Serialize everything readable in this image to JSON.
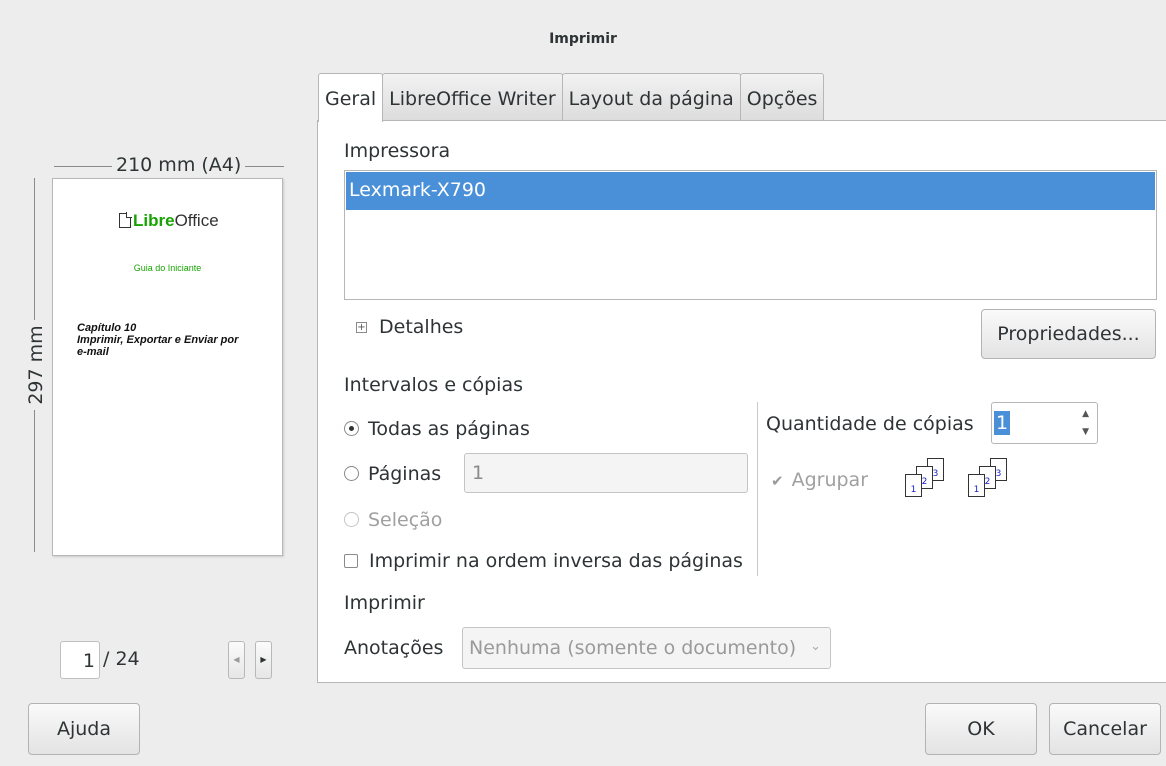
{
  "window": {
    "title": "Imprimir"
  },
  "preview": {
    "width_label": "210 mm (A4)",
    "height_label": "297 mm",
    "logo_libre": "Libre",
    "logo_office": "Office",
    "subtitle": "Guia do Iniciante",
    "chapter_line1": "Capítulo 10",
    "chapter_line2": "Imprimir, Exportar e Enviar por",
    "chapter_line3": "e-mail",
    "current_page": "1",
    "total_pages": "/ 24"
  },
  "tabs": [
    {
      "label": "Geral",
      "active": true
    },
    {
      "label": "LibreOffice Writer",
      "active": false
    },
    {
      "label": "Layout da página",
      "active": false
    },
    {
      "label": "Opções",
      "active": false
    }
  ],
  "printer": {
    "section_title": "Impressora",
    "items": [
      "Lexmark-X790"
    ],
    "details_label": "Detalhes",
    "properties_button": "Propriedades..."
  },
  "ranges": {
    "section_title": "Intervalos e cópias",
    "all_pages": "Todas as páginas",
    "pages": "Páginas",
    "pages_value": "1",
    "selection": "Seleção",
    "reverse_order": "Imprimir na ordem inversa das páginas",
    "copies_label": "Quantidade de cópias",
    "copies_value": "1",
    "collate_label": "Agrupar"
  },
  "print_section": {
    "section_title": "Imprimir",
    "annotations_label": "Anotações",
    "annotations_value": "Nenhuma (somente o documento)"
  },
  "footer": {
    "help_button": "Ajuda",
    "ok_button": "OK",
    "cancel_button": "Cancelar"
  },
  "icons": {
    "expander": "plus-box-icon",
    "spin_up": "chevron-up-icon",
    "spin_down": "chevron-down-icon",
    "select_chevron": "chevron-down-icon",
    "prev": "triangle-left-icon",
    "next": "triangle-right-icon"
  },
  "colors": {
    "selection": "#4a90d9",
    "logo_green": "#18a303"
  }
}
